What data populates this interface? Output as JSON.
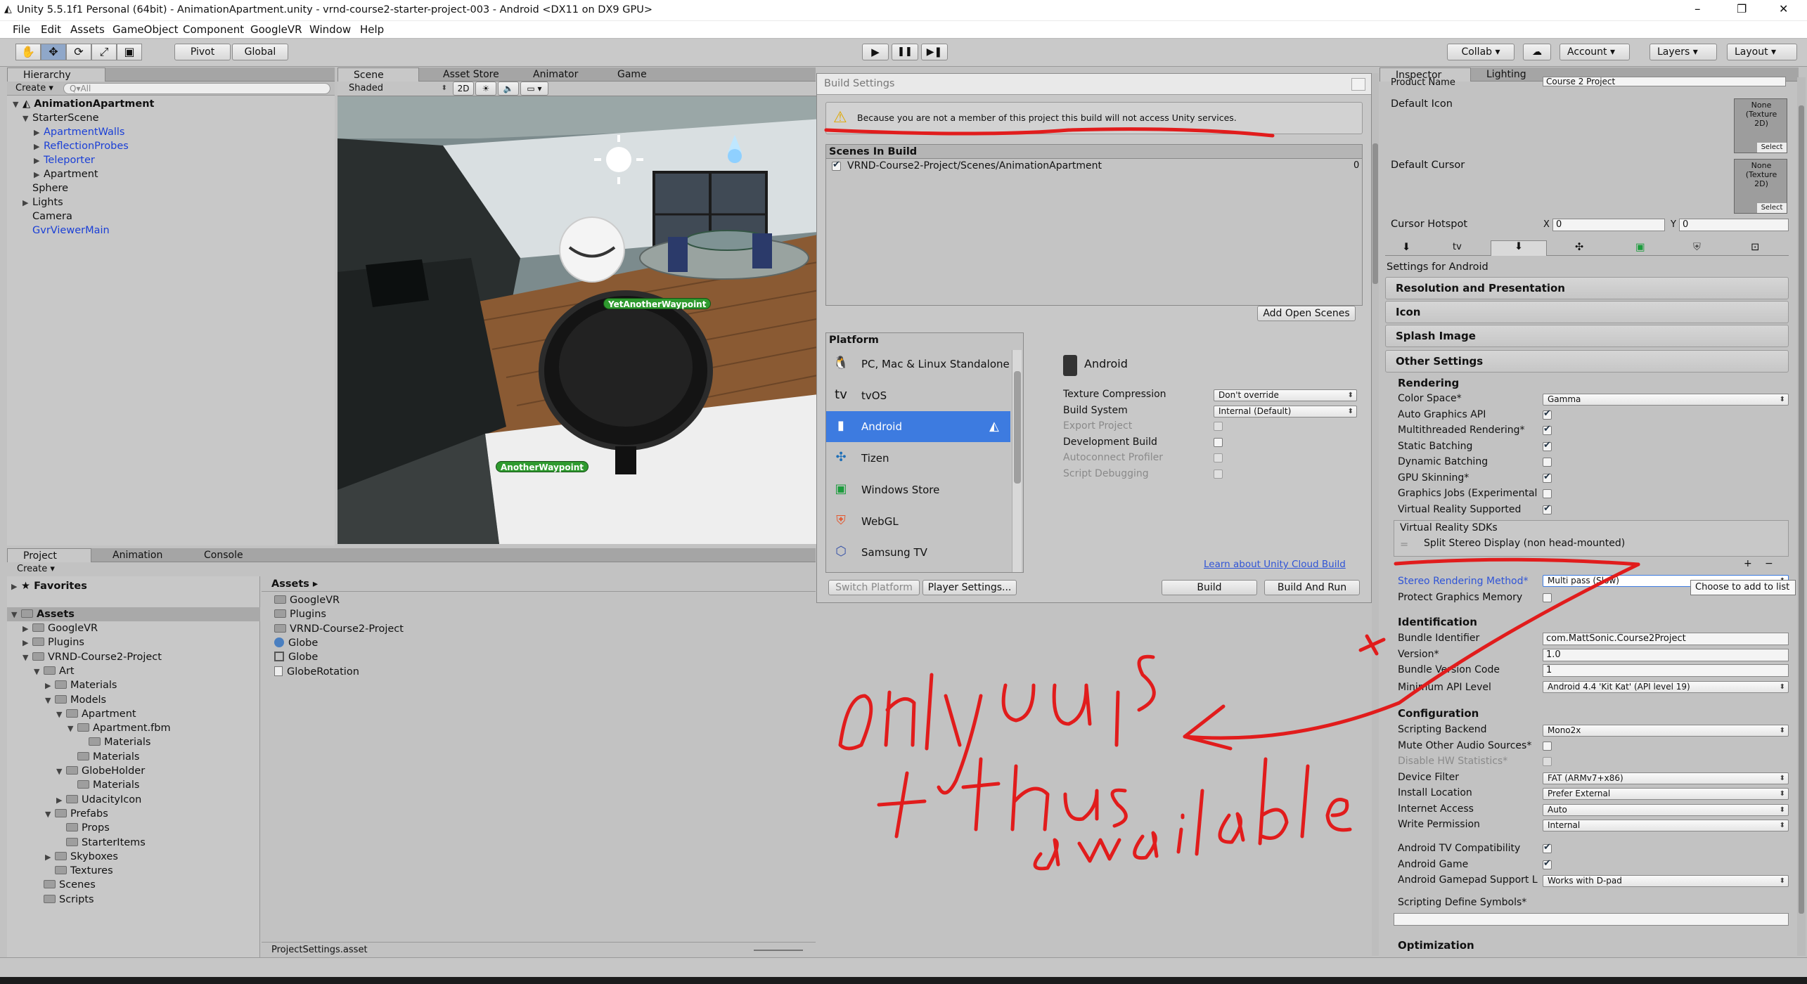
{
  "window": {
    "title": "Unity 5.5.1f1 Personal (64bit) - AnimationApartment.unity - vrnd-course2-starter-project-003 - Android <DX11 on DX9 GPU>",
    "controls": [
      "–",
      "❐",
      "✕"
    ]
  },
  "menu": [
    "File",
    "Edit",
    "Assets",
    "GameObject",
    "Component",
    "GoogleVR",
    "Window",
    "Help"
  ],
  "toolbar": {
    "pivot": "Pivot",
    "global": "Global",
    "collab": "Collab ▾",
    "account": "Account",
    "layers": "Layers",
    "layout": "Layout"
  },
  "hierarchy": {
    "tab": "Hierarchy",
    "create": "Create ▾",
    "search_placeholder": "Q▾All",
    "scene": "AnimationApartment",
    "items": [
      {
        "label": "StarterScene",
        "blue": false
      },
      {
        "label": "ApartmentWalls",
        "blue": true
      },
      {
        "label": "ReflectionProbes",
        "blue": true
      },
      {
        "label": "Teleporter",
        "blue": true
      },
      {
        "label": "Apartment",
        "blue": false
      },
      {
        "label": "Sphere",
        "blue": false
      },
      {
        "label": "Lights",
        "blue": false
      },
      {
        "label": "Camera",
        "blue": false
      },
      {
        "label": "GvrViewerMain",
        "blue": true
      }
    ]
  },
  "scene_view": {
    "tabs": [
      "Scene",
      "Asset Store",
      "Animator",
      "Game"
    ],
    "shading": "Shaded",
    "mode_2d": "2D",
    "waypoints": [
      "YetAnotherWaypoint",
      "AnotherWaypoint"
    ]
  },
  "project": {
    "tabs": [
      "Project",
      "Animation",
      "Console"
    ],
    "create": "Create ▾",
    "favorites": "Favorites",
    "assets_root": "Assets",
    "tree": [
      "GoogleVR",
      "Plugins",
      "VRND-Course2-Project",
      "Art",
      "Materials",
      "Models",
      "Apartment",
      "Apartment.fbm",
      "Materials",
      "Materials",
      "GlobeHolder",
      "Materials",
      "UdacityIcon",
      "Prefabs",
      "Props",
      "StarterItems",
      "Skyboxes",
      "Textures",
      "Scenes",
      "Scripts"
    ],
    "breadcrumb": "Assets ▸",
    "assets": [
      "GoogleVR",
      "Plugins",
      "VRND-Course2-Project",
      "Globe",
      "Globe",
      "GlobeRotation"
    ],
    "footer_file": "ProjectSettings.asset"
  },
  "build_settings": {
    "title": "Build Settings",
    "warning": "Because you are not a member of this project this build will not access Unity services.",
    "scenes_header": "Scenes In Build",
    "scene_path": "VRND-Course2-Project/Scenes/AnimationApartment",
    "scene_index": "0",
    "add_open_scenes": "Add Open Scenes",
    "platform_header": "Platform",
    "platforms": [
      "PC, Mac & Linux Standalone",
      "tvOS",
      "Android",
      "Tizen",
      "Windows Store",
      "WebGL",
      "Samsung TV"
    ],
    "selected_platform": "Android",
    "options": [
      {
        "label": "Texture Compression",
        "value": "Don't override",
        "kind": "dropdown"
      },
      {
        "label": "Build System",
        "value": "Internal (Default)",
        "kind": "dropdown"
      },
      {
        "label": "Export Project",
        "kind": "check",
        "disabled": true
      },
      {
        "label": "Development Build",
        "kind": "check",
        "disabled": false
      },
      {
        "label": "Autoconnect Profiler",
        "kind": "check",
        "disabled": true
      },
      {
        "label": "Script Debugging",
        "kind": "check",
        "disabled": true
      }
    ],
    "cloud_link": "Learn about Unity Cloud Build",
    "switch_platform": "Switch Platform",
    "player_settings": "Player Settings...",
    "build": "Build",
    "build_and_run": "Build And Run"
  },
  "inspector": {
    "tabs": [
      "Inspector",
      "Lighting"
    ],
    "product_name_label": "Product Name",
    "product_name": "Course 2 Project",
    "default_icon": "Default Icon",
    "default_cursor": "Default Cursor",
    "texture_none": "None (Texture 2D)",
    "select": "Select",
    "cursor_hotspot": "Cursor Hotspot",
    "hotspot_x_label": "X",
    "hotspot_x": "0",
    "hotspot_y_label": "Y",
    "hotspot_y": "0",
    "settings_for": "Settings for Android",
    "sections": [
      "Resolution and Presentation",
      "Icon",
      "Splash Image"
    ],
    "other_settings": "Other Settings",
    "rendering": "Rendering",
    "rendering_rows": [
      {
        "label": "Color Space*",
        "kind": "dropdown",
        "value": "Gamma"
      },
      {
        "label": "Auto Graphics API",
        "kind": "check",
        "on": true
      },
      {
        "label": "Multithreaded Rendering*",
        "kind": "check",
        "on": true
      },
      {
        "label": "Static Batching",
        "kind": "check",
        "on": true
      },
      {
        "label": "Dynamic Batching",
        "kind": "check",
        "on": false
      },
      {
        "label": "GPU Skinning*",
        "kind": "check",
        "on": true
      },
      {
        "label": "Graphics Jobs (Experimental",
        "kind": "check",
        "on": false
      },
      {
        "label": "Virtual Reality Supported",
        "kind": "check",
        "on": true
      }
    ],
    "vr_sdks": "Virtual Reality SDKs",
    "vr_sdk_item": "Split Stereo Display (non head-mounted)",
    "tooltip": "Choose to add to list",
    "stereo_label": "Stereo Rendering Method*",
    "stereo_value": "Multi pass (Slow)",
    "protect_label": "Protect Graphics Memory",
    "identification": "Identification",
    "ident_rows": [
      {
        "label": "Bundle Identifier",
        "value": "com.MattSonic.Course2Project"
      },
      {
        "label": "Version*",
        "value": "1.0"
      },
      {
        "label": "Bundle Version Code",
        "value": "1"
      }
    ],
    "min_api_label": "Minimum API Level",
    "min_api": "Android 4.4 'Kit Kat' (API level 19)",
    "configuration": "Configuration",
    "config_rows": [
      {
        "label": "Scripting Backend",
        "kind": "dropdown",
        "value": "Mono2x"
      },
      {
        "label": "Mute Other Audio Sources*",
        "kind": "check",
        "on": false
      },
      {
        "label": "Disable HW Statistics*",
        "kind": "check",
        "on": false,
        "disabled": true
      },
      {
        "label": "Device Filter",
        "kind": "dropdown",
        "value": "FAT (ARMv7+x86)"
      },
      {
        "label": "Install Location",
        "kind": "dropdown",
        "value": "Prefer External"
      },
      {
        "label": "Internet Access",
        "kind": "dropdown",
        "value": "Auto"
      },
      {
        "label": "Write Permission",
        "kind": "dropdown",
        "value": "Internal"
      }
    ],
    "tv_rows": [
      {
        "label": "Android TV Compatibility",
        "kind": "check",
        "on": true
      },
      {
        "label": "Android Game",
        "kind": "check",
        "on": true
      },
      {
        "label": "Android Gamepad Support L",
        "kind": "dropdown",
        "value": "Works with D-pad"
      }
    ],
    "define_symbols": "Scripting Define Symbols*",
    "optimization": "Optimization"
  },
  "colors": {
    "selection": "#3d7be0",
    "annotation": "#e11c1c",
    "link": "#2f54d6"
  }
}
